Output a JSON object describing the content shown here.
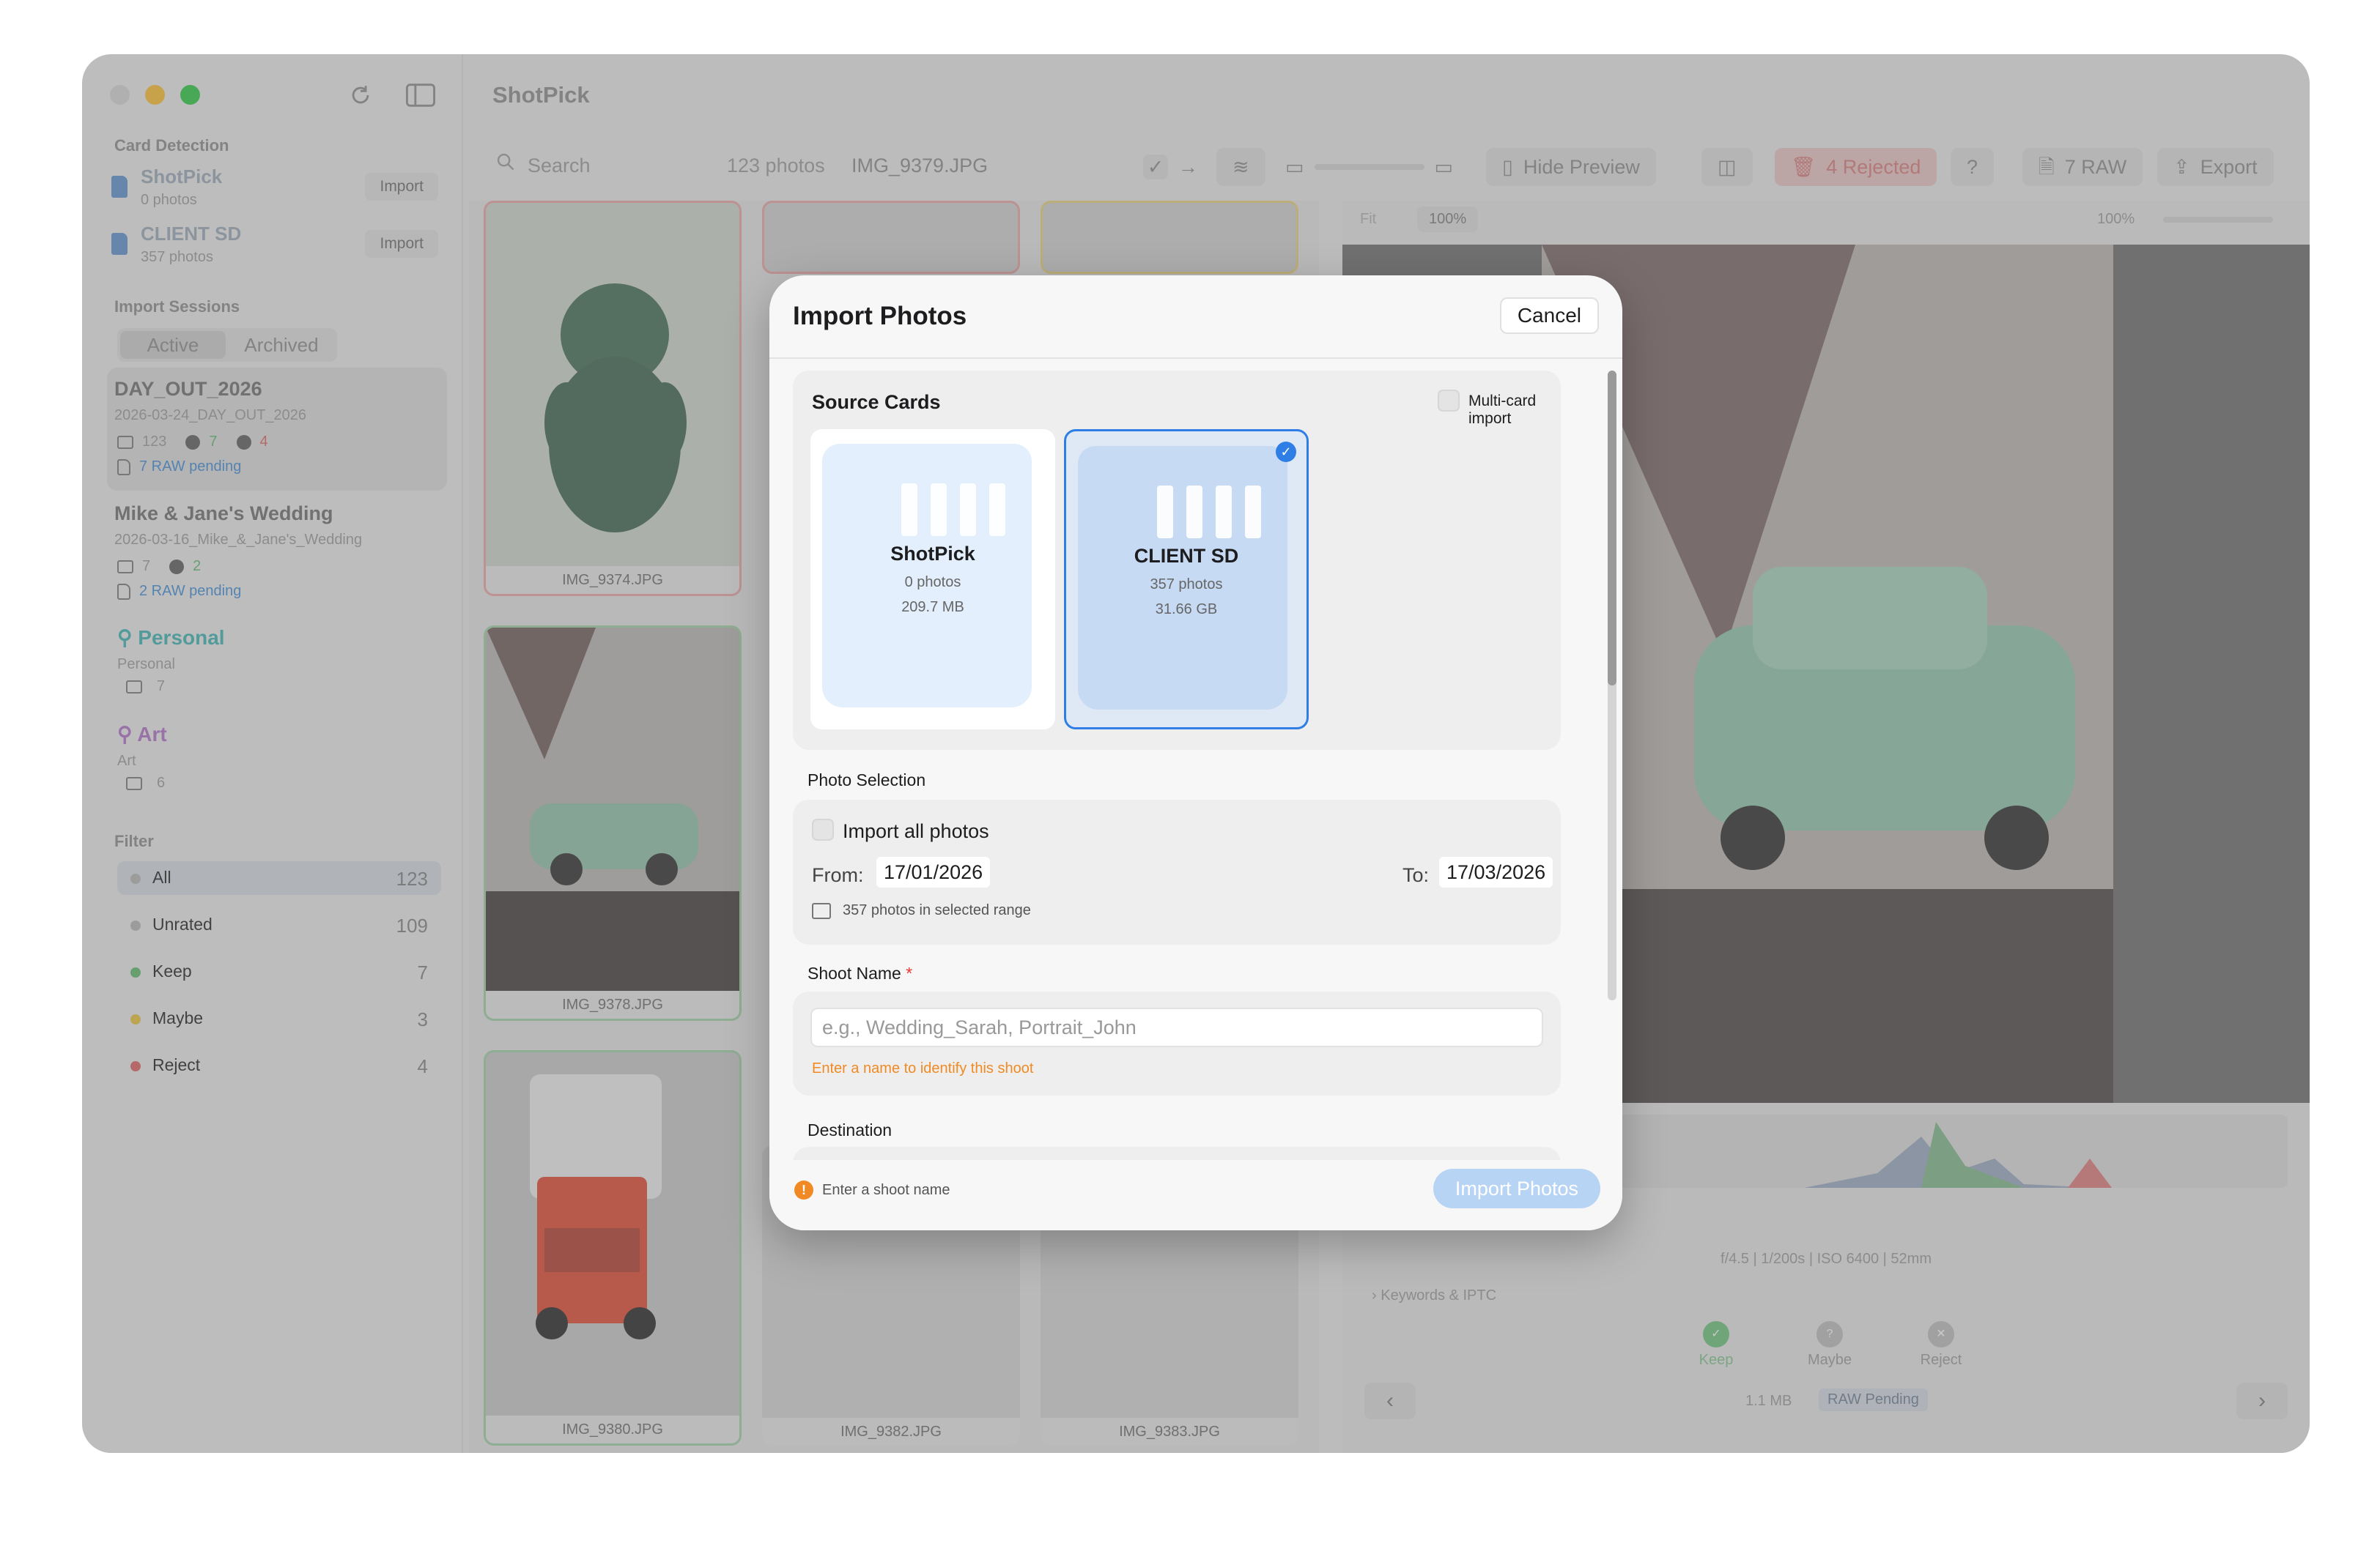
{
  "app": {
    "title": "ShotPick"
  },
  "sidebar": {
    "card_detection_title": "Card Detection",
    "cards": [
      {
        "name": "ShotPick",
        "count": "0 photos",
        "button": "Import"
      },
      {
        "name": "CLIENT SD",
        "count": "357 photos",
        "button": "Import"
      }
    ],
    "import_sessions_title": "Import Sessions",
    "tabs": {
      "active": "Active",
      "archived": "Archived"
    },
    "sessions": [
      {
        "title": "DAY_OUT_2026",
        "path": "2026-03-24_DAY_OUT_2026",
        "photos": "123",
        "keep": "7",
        "reject": "4",
        "raw": "7 RAW pending"
      },
      {
        "title": "Mike & Jane's Wedding",
        "path": "2026-03-16_Mike_&_Jane's_Wedding",
        "photos": "7",
        "keep": "2",
        "raw": "2 RAW pending"
      }
    ],
    "tags": [
      {
        "name": "Personal",
        "sub": "Personal",
        "count": "7"
      },
      {
        "name": "Art",
        "sub": "Art",
        "count": "6"
      }
    ],
    "filter_title": "Filter",
    "filters": [
      {
        "label": "All",
        "count": "123",
        "color": "#b5b5b5"
      },
      {
        "label": "Unrated",
        "count": "109",
        "color": "#b5b5b5"
      },
      {
        "label": "Keep",
        "count": "7",
        "color": "#5cba6a"
      },
      {
        "label": "Maybe",
        "count": "3",
        "color": "#e9c23a"
      },
      {
        "label": "Reject",
        "count": "4",
        "color": "#e06060"
      }
    ]
  },
  "toolbar": {
    "search_placeholder": "Search",
    "photo_count": "123 photos",
    "current_file": "IMG_9379.JPG",
    "hide_preview": "Hide Preview",
    "rejected": "4 Rejected",
    "raw": "7 RAW",
    "export": "Export"
  },
  "grid": {
    "thumbs": [
      "IMG_9374.JPG",
      "IMG_9378.JPG",
      "IMG_9380.JPG",
      "IMG_9382.JPG",
      "IMG_9383.JPG"
    ]
  },
  "preview": {
    "fit": "Fit",
    "zoom": "100%",
    "zoom_right": "100%",
    "exif": "f/4.5 | 1/200s | ISO 6400 | 52mm",
    "keywords": "Keywords & IPTC",
    "actions": {
      "keep": "Keep",
      "maybe": "Maybe",
      "reject": "Reject"
    },
    "size": "1.1 MB",
    "raw_badge": "RAW Pending"
  },
  "modal": {
    "title": "Import Photos",
    "cancel": "Cancel",
    "source_cards_title": "Source Cards",
    "multi_card": "Multi-card import",
    "cards": [
      {
        "name": "ShotPick",
        "photos": "0 photos",
        "size": "209.7 MB",
        "selected": false
      },
      {
        "name": "CLIENT SD",
        "photos": "357 photos",
        "size": "31.66 GB",
        "selected": true
      }
    ],
    "photo_selection_title": "Photo Selection",
    "import_all": "Import all photos",
    "from_label": "From:",
    "from_value": "17/01/2026",
    "to_label": "To:",
    "to_value": "17/03/2026",
    "range_info": "357 photos in selected range",
    "shoot_name_title": "Shoot Name",
    "required_mark": "*",
    "shoot_placeholder": "e.g., Wedding_Sarah, Portrait_John",
    "shoot_hint": "Enter a name to identify this shoot",
    "destination_title": "Destination",
    "footer_warning": "Enter a shoot name",
    "import_button": "Import Photos"
  },
  "colors": {
    "accent": "#2f7ee6",
    "warning": "#f08a24",
    "selected_card": "#cfe0f7",
    "card_bg": "#e3effc"
  }
}
